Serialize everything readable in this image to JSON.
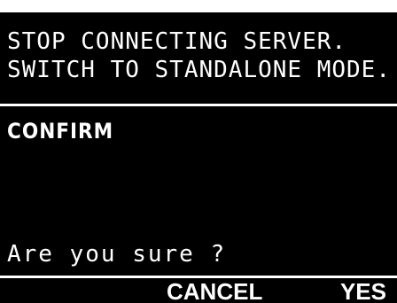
{
  "message": {
    "line1": "STOP CONNECTING SERVER.",
    "line2": "SWITCH TO STANDALONE MODE."
  },
  "dialog": {
    "title": "CONFIRM",
    "question": "Are you sure ?"
  },
  "softkeys": {
    "cancel_label": "CANCEL",
    "yes_label": "YES"
  },
  "colors": {
    "background": "#000000",
    "foreground": "#ffffff"
  }
}
